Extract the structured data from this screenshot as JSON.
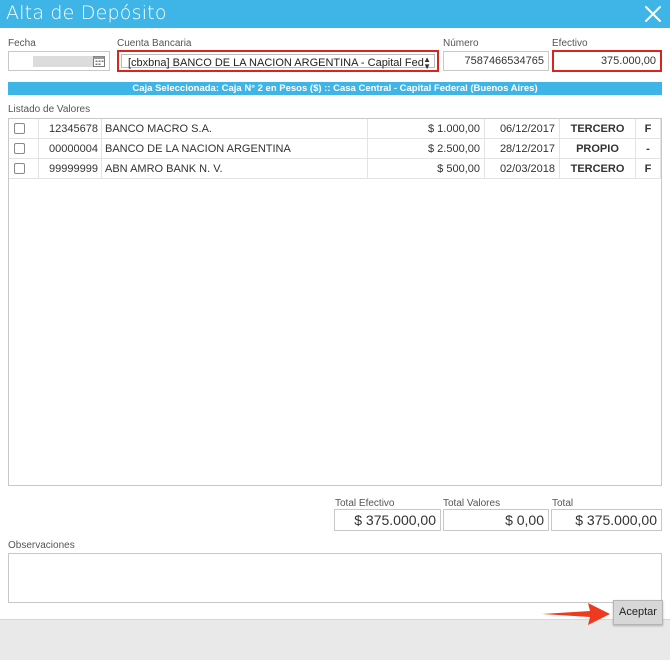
{
  "window": {
    "title": "Alta de Depósito",
    "accent_color": "#3fb4e6",
    "highlight_color": "#d9261c",
    "close_icon": "close-icon"
  },
  "form": {
    "fecha_label": "Fecha",
    "cuenta_label": "Cuenta Bancaria",
    "cuenta_value": "[cbxbna] BANCO DE LA NACION ARGENTINA - Capital Feder",
    "numero_label": "Número",
    "numero_value": "7587466534765",
    "efectivo_label": "Efectivo",
    "efectivo_value": "375.000,00"
  },
  "caja_bar": "Caja Seleccionada: Caja N° 2 en Pesos ($) :: Casa Central - Capital Federal (Buenos Aires)",
  "listado": {
    "label": "Listado de Valores",
    "rows": [
      {
        "code": "12345678",
        "bank": "BANCO MACRO S.A.",
        "amount": "$ 1.000,00",
        "date": "06/12/2017",
        "tipo": "TERCERO",
        "flag": "F",
        "checked": false
      },
      {
        "code": "00000004",
        "bank": "BANCO DE LA NACION ARGENTINA",
        "amount": "$ 2.500,00",
        "date": "28/12/2017",
        "tipo": "PROPIO",
        "flag": "-",
        "checked": false
      },
      {
        "code": "99999999",
        "bank": "ABN AMRO BANK N. V.",
        "amount": "$ 500,00",
        "date": "02/03/2018",
        "tipo": "TERCERO",
        "flag": "F",
        "checked": false
      }
    ]
  },
  "totals": {
    "efectivo_label": "Total Efectivo",
    "efectivo_value": "$ 375.000,00",
    "valores_label": "Total Valores",
    "valores_value": "$ 0,00",
    "total_label": "Total",
    "total_value": "$ 375.000,00"
  },
  "observaciones_label": "Observaciones",
  "footer": {
    "aceptar_label": "Aceptar"
  }
}
